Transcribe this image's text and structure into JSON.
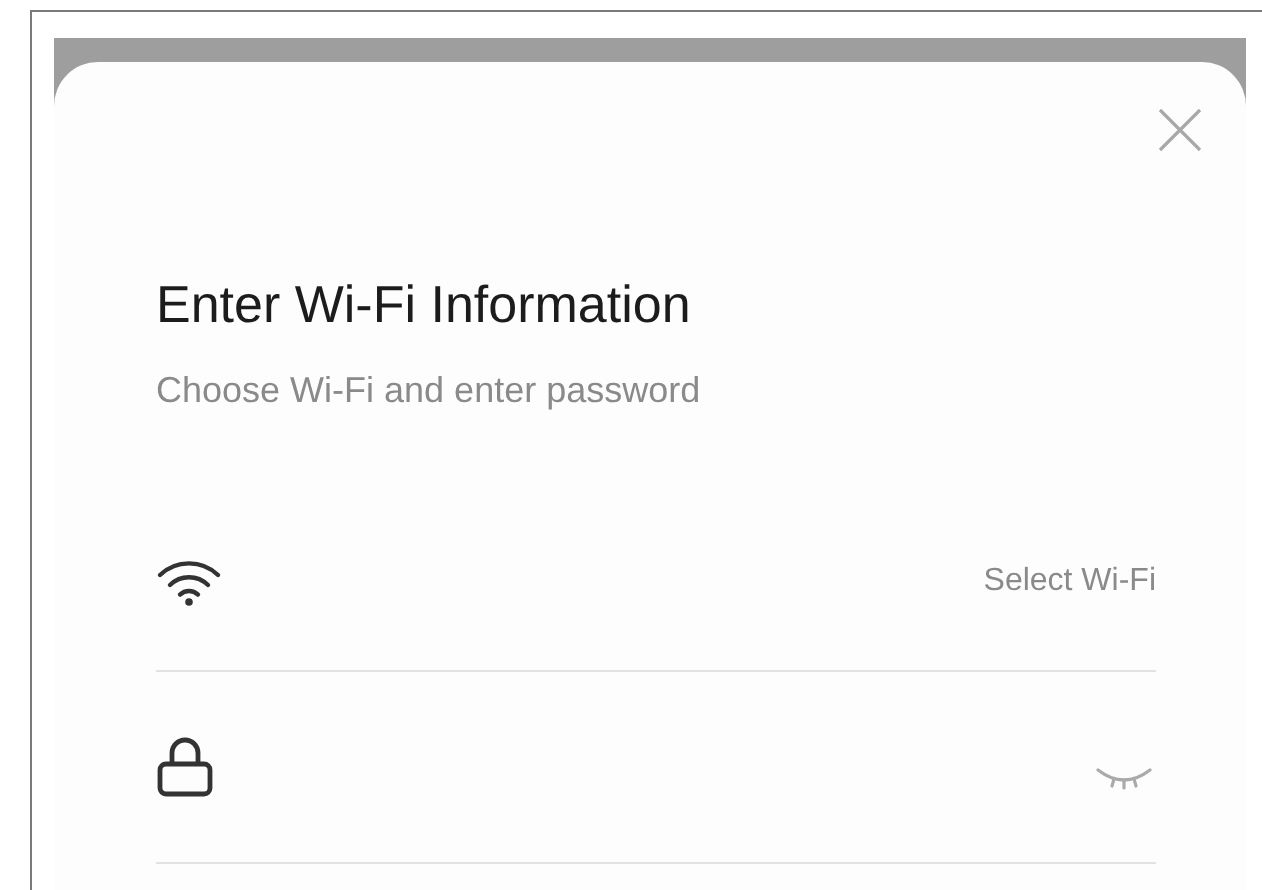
{
  "dialog": {
    "title": "Enter Wi-Fi Information",
    "subtitle": "Choose Wi-Fi and enter password"
  },
  "network_row": {
    "value": "Select Wi-Fi"
  }
}
